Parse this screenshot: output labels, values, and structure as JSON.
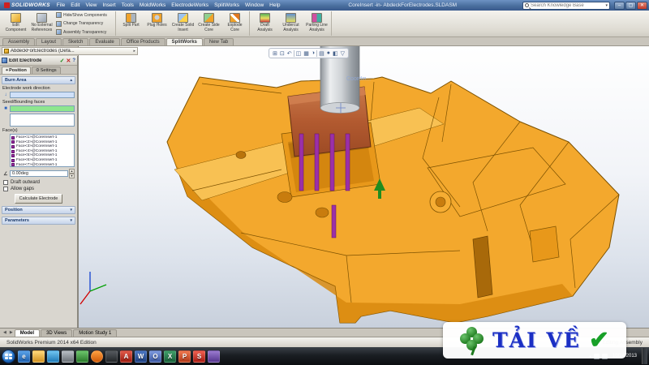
{
  "app": {
    "logo": "SOLIDWORKS",
    "menus": [
      "File",
      "Edit",
      "View",
      "Insert",
      "Tools",
      "MoldWorks",
      "ElectrodeWorks",
      "SplitWorks",
      "Window",
      "Help"
    ],
    "document_title": "CoreInsert -in- AbdeckForElectrodes.SLDASM",
    "search_placeholder": "Search Knowledge Base",
    "window_buttons": {
      "minimize": "–",
      "maximize": "▢",
      "close": "✕"
    }
  },
  "ribbon": {
    "big_buttons": [
      {
        "name": "edit-component",
        "label": "Edit Component"
      },
      {
        "name": "no-external-references",
        "label": "No External References"
      },
      {
        "name": "split-part",
        "label": "Split Part"
      },
      {
        "name": "plug-holes",
        "label": "Plug Holes"
      },
      {
        "name": "create-solid-insert",
        "label": "Create Solid Insert"
      },
      {
        "name": "create-side-core",
        "label": "Create Side Core"
      },
      {
        "name": "explode-core",
        "label": "Explode Core"
      },
      {
        "name": "draft-analysis",
        "label": "Draft Analysis"
      },
      {
        "name": "undercut-analysis",
        "label": "Undercut Analysis"
      },
      {
        "name": "parting-line-analysis",
        "label": "Parting Line Analysis"
      }
    ],
    "small_buttons": [
      {
        "label": "Hide/Show Components"
      },
      {
        "label": "Change Transparency"
      },
      {
        "label": "Assembly Transparency"
      }
    ]
  },
  "command_tabs": {
    "items": [
      "Assembly",
      "Layout",
      "Sketch",
      "Evaluate",
      "Office Products",
      "SplitWorks",
      "New Tab"
    ],
    "active": "SplitWorks"
  },
  "feature_tree": {
    "root_label": "AbdeckForElectrodes (Defa..."
  },
  "property_manager": {
    "title": "Edit Electrode",
    "header_icons": {
      "ok": "✓",
      "cancel": "✕",
      "help": "?"
    },
    "tabs": [
      {
        "label": "Position",
        "icon": "⌖"
      },
      {
        "label": "Settings",
        "icon": "⚙"
      }
    ],
    "burn_area": {
      "title": "Burn Area",
      "work_direction_label": "Electrode work direction",
      "seed_faces_label": "Seed/Bounding faces",
      "faces_label": "Face(s)",
      "faces": [
        "Face<1>@CoreInsert-1",
        "Face<2>@CoreInsert-1",
        "Face<3>@CoreInsert-1",
        "Face<4>@CoreInsert-1",
        "Face<5>@CoreInsert-1",
        "Face<6>@CoreInsert-1",
        "Face<7>@CoreInsert-1"
      ],
      "angle_value": "0.00deg",
      "draft_outward_label": "Draft outward",
      "allow_gaps_label": "Allow gaps",
      "calculate_button": "Calculate Electrode"
    },
    "collapsed_groups": [
      "Position",
      "Parameters"
    ]
  },
  "viewport": {
    "hud_icons": [
      {
        "name": "zoom-to-fit-icon",
        "glyph": "⊞"
      },
      {
        "name": "zoom-to-area-icon",
        "glyph": "⊡"
      },
      {
        "name": "previous-view-icon",
        "glyph": "↶"
      },
      {
        "name": "section-view-icon",
        "glyph": "◫"
      },
      {
        "name": "view-orientation-icon",
        "glyph": "▦"
      },
      {
        "name": "display-style-icon",
        "glyph": "◑"
      },
      {
        "name": "hide-show-items-icon",
        "glyph": "▤"
      },
      {
        "name": "edit-appearance-icon",
        "glyph": "●"
      },
      {
        "name": "apply-scene-icon",
        "glyph": "◧"
      },
      {
        "name": "view-settings-icon",
        "glyph": "▽"
      }
    ],
    "coordinate_label": "Coordin...",
    "model_tabs": [
      "Model",
      "3D Views",
      "Motion Study 1"
    ]
  },
  "status_bar": {
    "left": "SolidWorks Premium 2014 x64 Edition",
    "right": "Editing Assembly"
  },
  "taskbar": {
    "icons": [
      {
        "name": "internet-explorer-icon",
        "glyph": "e"
      },
      {
        "name": "windows-explorer-icon",
        "glyph": ""
      },
      {
        "name": "media-player-icon",
        "glyph": ""
      },
      {
        "name": "control-panel-icon",
        "glyph": ""
      },
      {
        "name": "green-app-icon",
        "glyph": ""
      },
      {
        "name": "firefox-icon",
        "glyph": ""
      },
      {
        "name": "command-prompt-icon",
        "glyph": ""
      },
      {
        "name": "acrobat-icon",
        "glyph": "A"
      },
      {
        "name": "word-icon",
        "glyph": "W"
      },
      {
        "name": "outlook-icon",
        "glyph": "O"
      },
      {
        "name": "excel-icon",
        "glyph": "X"
      },
      {
        "name": "powerpoint-icon",
        "glyph": "P"
      },
      {
        "name": "solidworks-icon",
        "glyph": "S"
      },
      {
        "name": "purple-app-icon",
        "glyph": ""
      }
    ],
    "clock_date": "10/14/2013"
  },
  "watermark": {
    "text": "TẢI VỀ",
    "check_glyph": "✔"
  },
  "icons": {
    "chevron_up": "▴",
    "chevron_down": "▾",
    "flyout_arrow": "▸",
    "spin_up": "▲",
    "spin_down": "▼",
    "angle": "∠",
    "work_direction": "↓",
    "face_swatch": "■",
    "tab_prev": "◀",
    "tab_next": "▶",
    "tray_expand": "▴"
  },
  "colors": {
    "model_primary": "#f3a82d",
    "model_shadow": "#d8890f",
    "electrode_block": "#b25a30",
    "electrode_pins": "#9b30a8",
    "selection_green": "#8ee68e",
    "selection_blue": "#cfe0f8",
    "titlebar_blue": "#4a6f9e"
  }
}
